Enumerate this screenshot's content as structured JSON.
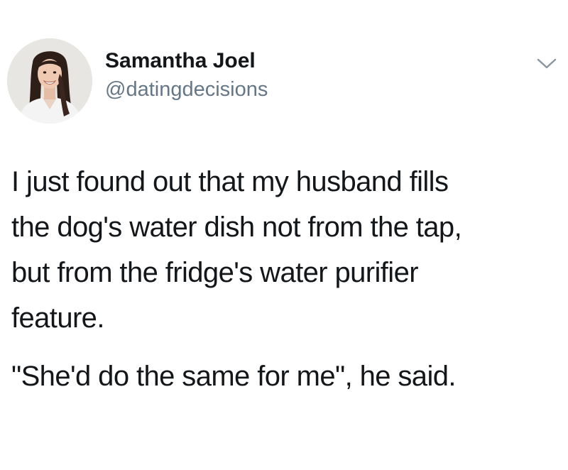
{
  "author": {
    "display_name": "Samantha Joel",
    "handle": "@datingdecisions",
    "avatar_icon": "profile-photo"
  },
  "menu": {
    "icon": "chevron-down-icon"
  },
  "tweet": {
    "paragraph_1_lines": [
      "I just found out that my husband fills",
      "the dog's water dish not from the tap,",
      "but from the fridge's water purifier",
      "feature."
    ],
    "paragraph_2": "\"She'd do the same for me\", he said."
  },
  "colors": {
    "text": "#14171a",
    "secondary_text": "#657786",
    "background": "#ffffff"
  }
}
